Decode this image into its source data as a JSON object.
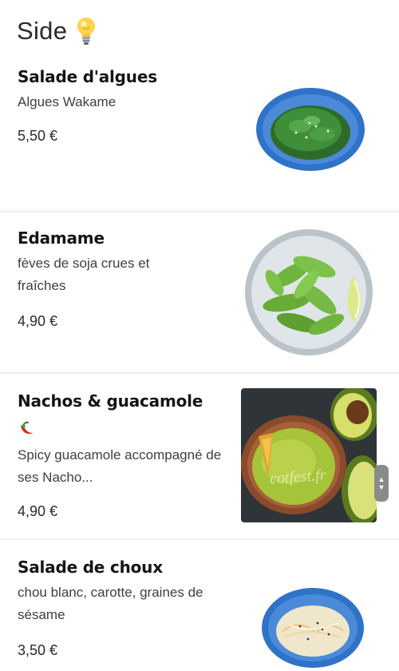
{
  "section": {
    "title": "Side",
    "icon": "lightbulb-icon"
  },
  "items": [
    {
      "name": "Salade d'algues",
      "description": "Algues Wakame",
      "price": "5,50 €",
      "image": "seaweed-salad-bowl"
    },
    {
      "name": "Edamame",
      "description": "fèves de soja crues et fraîches",
      "price": "4,90 €",
      "image": "edamame-bowl"
    },
    {
      "name": "Nachos & guacamole",
      "badge_icon": "chili-pepper-icon",
      "description": "Spicy guacamole accompagné de ses Nacho...",
      "price": "4,90 €",
      "image": "guacamole-avocado-photo"
    },
    {
      "name": "Salade de choux",
      "description": "chou blanc, carotte, graines de sésame",
      "price": "3,50 €",
      "image": "cabbage-salad-bowl"
    }
  ],
  "watermark": "cotfest.fr",
  "colors": {
    "bowl_blue": "#2f73c9",
    "seaweed_green": "#3f8f3a",
    "edamame_green": "#6fb43c",
    "guacamole_green": "#a6c43a",
    "divider": "#efefef"
  }
}
